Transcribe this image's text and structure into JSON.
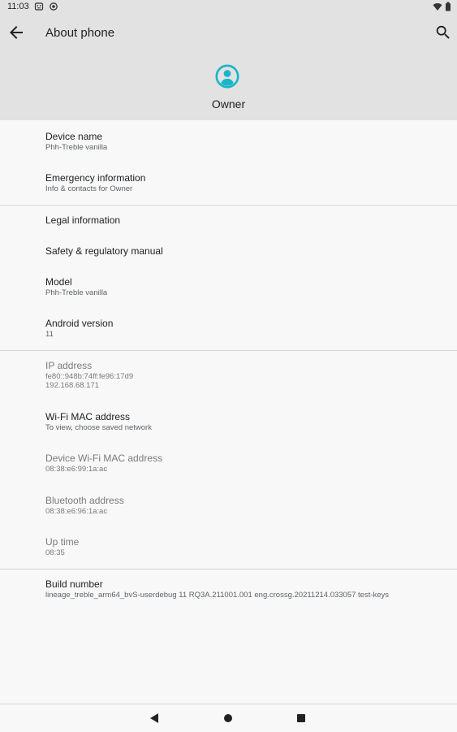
{
  "status_bar": {
    "time": "11:03",
    "icons": [
      "android-face-icon",
      "circle-dot-icon",
      "wifi-icon",
      "battery-icon"
    ]
  },
  "header": {
    "title": "About phone",
    "owner_name": "Owner",
    "accent_color": "#19b5c9"
  },
  "items": [
    {
      "title": "Device name",
      "subtitle": "Phh-Treble vanilla"
    },
    {
      "title": "Emergency information",
      "subtitle": "Info & contacts for Owner"
    },
    {
      "title": "Legal information"
    },
    {
      "title": "Safety & regulatory manual"
    },
    {
      "title": "Model",
      "subtitle": "Phh-Treble vanilla"
    },
    {
      "title": "Android version",
      "subtitle": "11"
    },
    {
      "title": "IP address",
      "subtitle": "fe80::948b:74ff:fe96:17d9",
      "subtitle2": "192.168.68.171"
    },
    {
      "title": "Wi-Fi MAC address",
      "subtitle": "To view, choose saved network"
    },
    {
      "title": "Device Wi-Fi MAC address",
      "subtitle": "08:38:e6:99:1a:ac"
    },
    {
      "title": "Bluetooth address",
      "subtitle": "08:38:e6:96:1a:ac"
    },
    {
      "title": "Up time",
      "subtitle": "08:35"
    },
    {
      "title": "Build number",
      "subtitle": "lineage_treble_arm64_bvS-userdebug 11 RQ3A.211001.001 eng.crossg.20211214.033057 test-keys"
    }
  ],
  "navigation": {
    "icons": [
      "back-triangle-icon",
      "home-circle-icon",
      "recents-square-icon"
    ]
  }
}
